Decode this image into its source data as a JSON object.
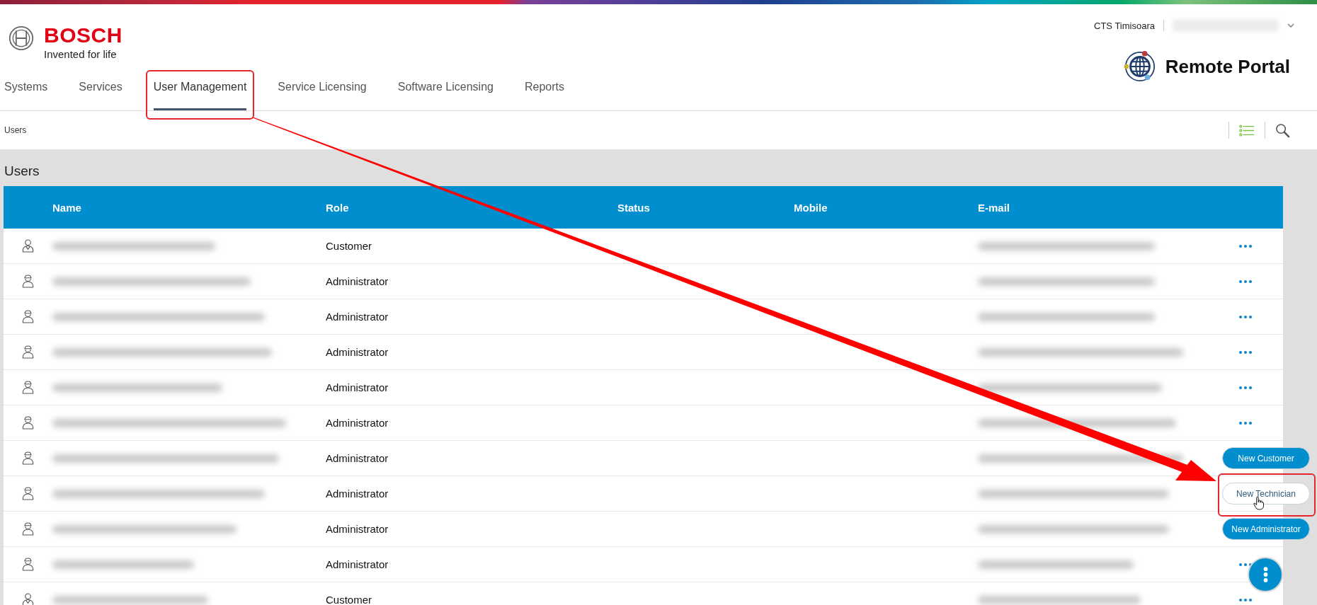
{
  "header": {
    "brand": "BOSCH",
    "tagline": "Invented for life",
    "location": "CTS Timisoara",
    "user_redacted": true,
    "app_name": "Remote Portal"
  },
  "tabs": [
    {
      "label": "Systems",
      "selected": false,
      "highlighted": false
    },
    {
      "label": "Services",
      "selected": false,
      "highlighted": false
    },
    {
      "label": "User Management",
      "selected": true,
      "highlighted": true
    },
    {
      "label": "Service Licensing",
      "selected": false,
      "highlighted": false
    },
    {
      "label": "Software Licensing",
      "selected": false,
      "highlighted": false
    },
    {
      "label": "Reports",
      "selected": false,
      "highlighted": false
    }
  ],
  "breadcrumb": "Users",
  "page_title": "Users",
  "table": {
    "columns": [
      "Name",
      "Role",
      "Status",
      "Mobile",
      "E-mail"
    ],
    "rows": [
      {
        "kind": "customer",
        "role": "Customer",
        "redacted": true
      },
      {
        "kind": "administrator",
        "role": "Administrator",
        "redacted": true
      },
      {
        "kind": "administrator",
        "role": "Administrator",
        "redacted": true
      },
      {
        "kind": "administrator",
        "role": "Administrator",
        "redacted": true
      },
      {
        "kind": "administrator",
        "role": "Administrator",
        "redacted": true
      },
      {
        "kind": "administrator",
        "role": "Administrator",
        "redacted": true
      },
      {
        "kind": "administrator",
        "role": "Administrator",
        "redacted": true
      },
      {
        "kind": "administrator",
        "role": "Administrator",
        "redacted": true
      },
      {
        "kind": "administrator",
        "role": "Administrator",
        "redacted": true
      },
      {
        "kind": "administrator",
        "role": "Administrator",
        "redacted": true
      },
      {
        "kind": "customer",
        "role": "Customer",
        "redacted": true
      }
    ]
  },
  "actions": [
    {
      "label": "New Customer",
      "hovered": false,
      "highlighted": false
    },
    {
      "label": "New Technician",
      "hovered": true,
      "highlighted": true
    },
    {
      "label": "New Administrator",
      "hovered": false,
      "highlighted": false
    }
  ],
  "annotation": {
    "kind": "arrow"
  }
}
